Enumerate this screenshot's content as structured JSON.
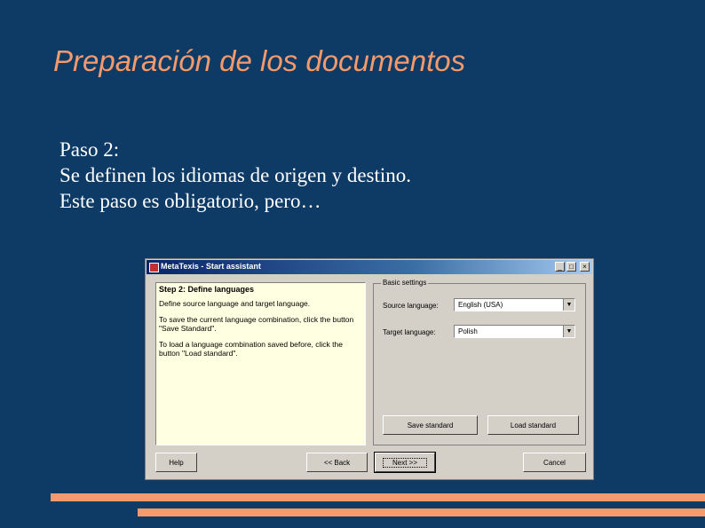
{
  "slide": {
    "title": "Preparación de los documentos",
    "lines": [
      "Paso 2:",
      "Se definen los idiomas de origen y destino.",
      "Este paso es obligatorio, pero…"
    ]
  },
  "window": {
    "title": "MetaTexis - Start assistant",
    "controls": {
      "minimize": "_",
      "maximize": "□",
      "close": "×"
    },
    "instructions": {
      "step_title": "Step 2: Define languages",
      "lines": [
        "Define source language and target language.",
        "To save the current language combination, click the button \"Save Standard\".",
        "To load a language combination saved before, click the button \"Load standard\"."
      ]
    },
    "settings": {
      "group_label": "Basic settings",
      "source_label": "Source language:",
      "source_value": "English (USA)",
      "target_label": "Target language:",
      "target_value": "Polish",
      "save_button": "Save standard",
      "load_button": "Load standard"
    },
    "footer": {
      "help": "Help",
      "back": "<< Back",
      "next": "Next >>",
      "cancel": "Cancel"
    }
  },
  "colors": {
    "background": "#0e3a66",
    "accent": "#f59a6c",
    "text": "#ffffff"
  }
}
